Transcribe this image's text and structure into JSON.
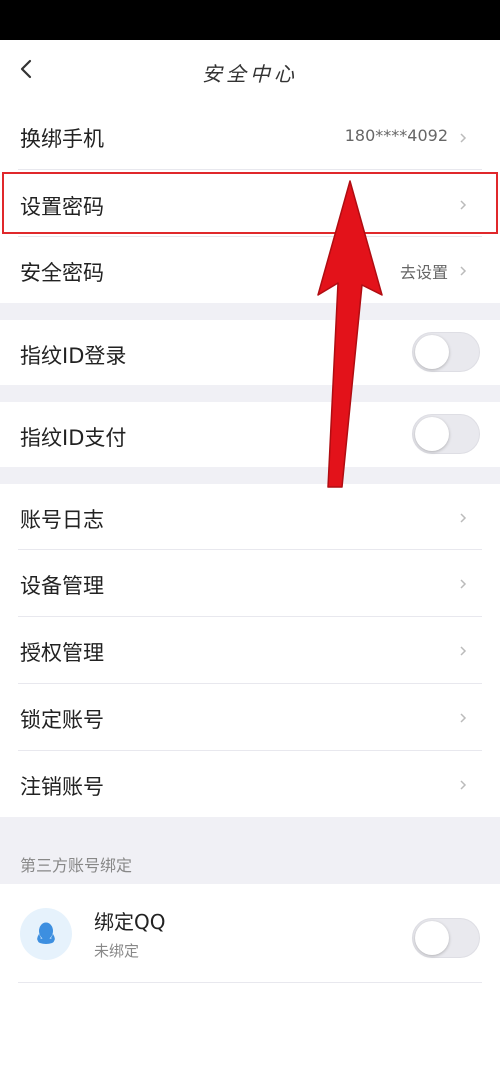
{
  "header": {
    "title": "安全中心"
  },
  "account_rows": [
    {
      "label": "换绑手机",
      "value": "180****4092"
    },
    {
      "label": "设置密码",
      "value": ""
    },
    {
      "label": "安全密码",
      "value": "去设置"
    }
  ],
  "fingerprint_login": {
    "label": "指纹ID登录",
    "enabled": false
  },
  "fingerprint_pay": {
    "label": "指纹ID支付",
    "enabled": false
  },
  "management_rows": [
    {
      "label": "账号日志"
    },
    {
      "label": "设备管理"
    },
    {
      "label": "授权管理"
    },
    {
      "label": "锁定账号"
    },
    {
      "label": "注销账号"
    }
  ],
  "third_party": {
    "section_title": "第三方账号绑定",
    "qq": {
      "title": "绑定QQ",
      "status": "未绑定",
      "enabled": false
    }
  },
  "colors": {
    "highlight": "#e0282b",
    "arrow": "#e3121a",
    "section_bg": "#f0f0f5",
    "qq_blue": "#3d8fe0"
  },
  "annotation": {
    "icon": "red-arrow-pointing-up"
  }
}
